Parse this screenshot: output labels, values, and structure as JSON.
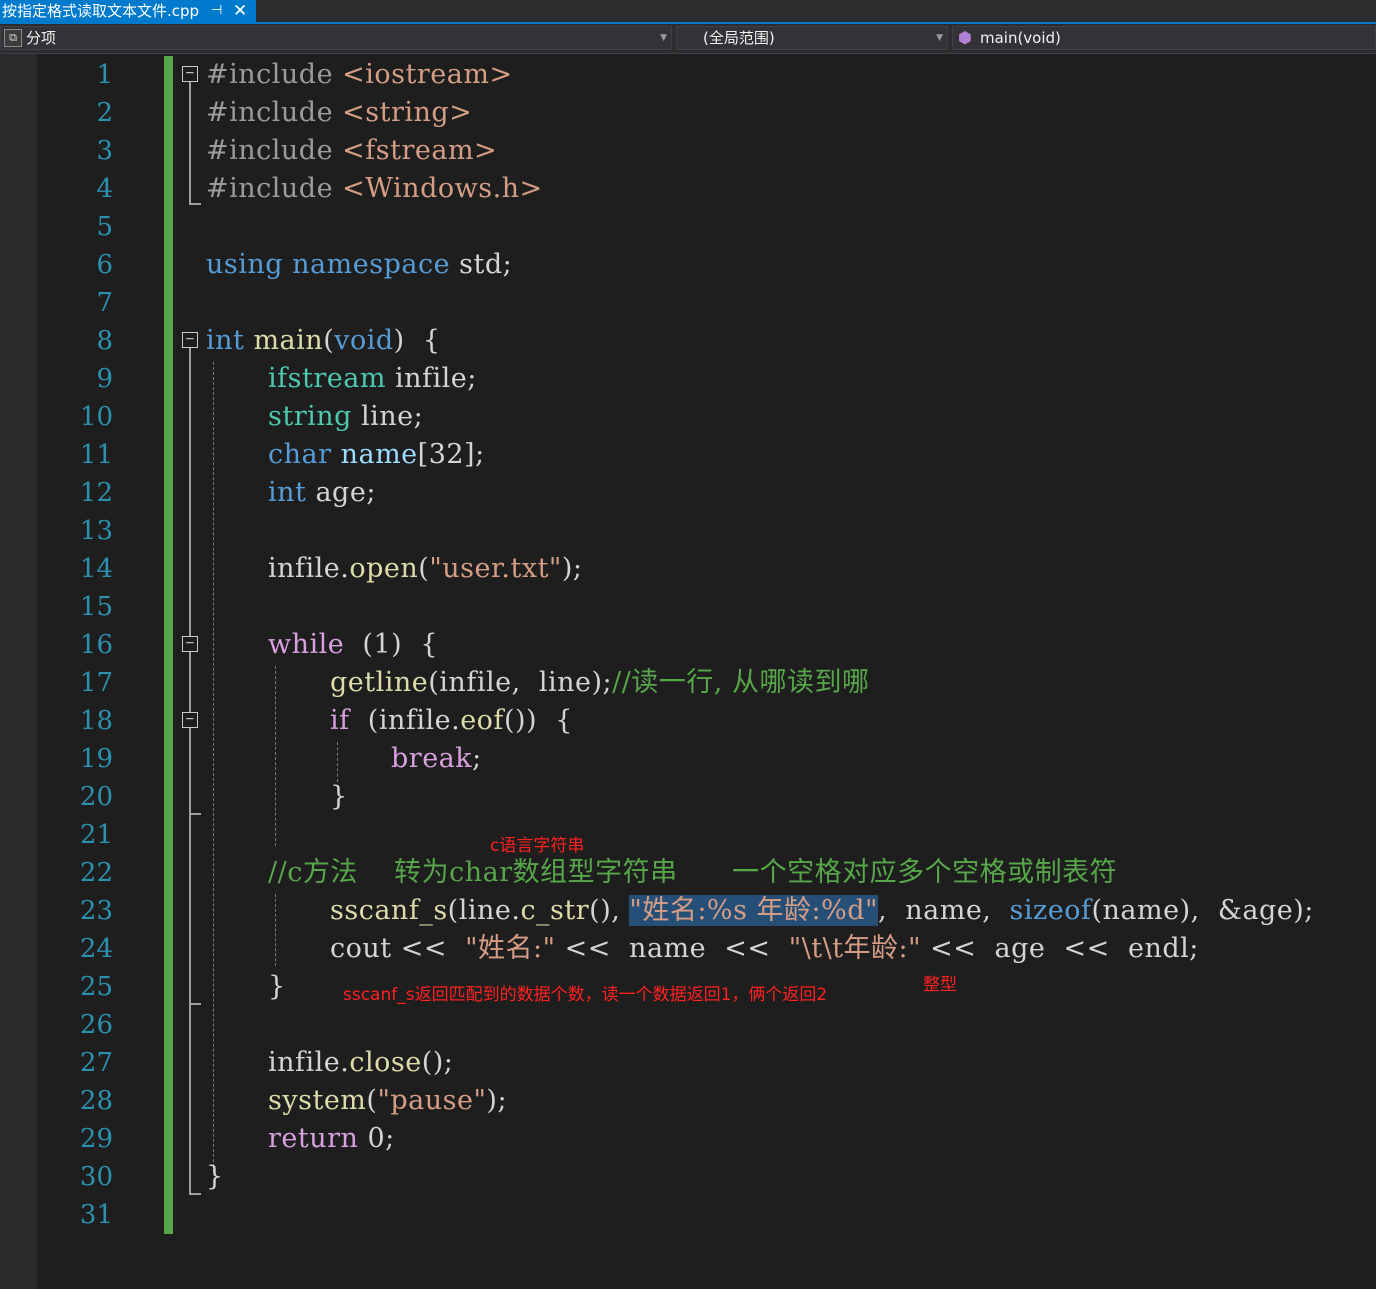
{
  "tab": {
    "filename": "按指定格式读取文本文件.cpp",
    "pin_glyph": "⊣",
    "close_glyph": "✕"
  },
  "navbar": {
    "project": "分项",
    "scope": "(全局范围)",
    "member": "main(void)"
  },
  "line_numbers": [
    "1",
    "2",
    "3",
    "4",
    "5",
    "6",
    "7",
    "8",
    "9",
    "10",
    "11",
    "12",
    "13",
    "14",
    "15",
    "16",
    "17",
    "18",
    "19",
    "20",
    "21",
    "22",
    "23",
    "24",
    "25",
    "26",
    "27",
    "28",
    "29",
    "30",
    "31"
  ],
  "code": {
    "l1": {
      "a": "#include ",
      "b": "<iostream>"
    },
    "l2": {
      "a": "#include ",
      "b": "<string>"
    },
    "l3": {
      "a": "#include ",
      "b": "<fstream>"
    },
    "l4": {
      "a": "#include ",
      "b": "<Windows.h>"
    },
    "l6": {
      "a": "using",
      "b": "namespace",
      "c": " std;"
    },
    "l8": {
      "a": "int",
      "b": " main",
      "c": "(",
      "d": "void",
      "e": ")  {"
    },
    "l9": {
      "a": "ifstream",
      "b": " infile;"
    },
    "l10": {
      "a": "string",
      "b": " line;"
    },
    "l11": {
      "a": "char",
      "b": " name",
      "c": "[32];"
    },
    "l12": {
      "a": "int",
      "b": " age;"
    },
    "l14": {
      "a": "infile.",
      "b": "open",
      "c": "(",
      "d": "\"user.txt\"",
      "e": ");"
    },
    "l16": {
      "a": "while",
      "b": "  (1)  {"
    },
    "l17": {
      "a": "getline",
      "b": "(infile,  line);",
      "c": "//读一行, 从哪读到哪"
    },
    "l18": {
      "a": "if",
      "b": "  (infile.",
      "c": "eof",
      "d": "())  {"
    },
    "l19": {
      "a": "break",
      "b": ";"
    },
    "l20": {
      "a": "}"
    },
    "l22": {
      "a": "//c方法    转为char数组型字符串      一个空格对应多个空格或制表符"
    },
    "l23": {
      "a": "sscanf_s",
      "b": "(line.",
      "c": "c_str",
      "d": "(), ",
      "e": "\"姓名:%s 年龄:%d\"",
      "f": ",  name,  ",
      "g": "sizeof",
      "h": "(name),  &age);"
    },
    "l24": {
      "a": "cout",
      "b": " <<  ",
      "c": "\"姓名:\"",
      "d": " <<  name  <<  ",
      "e": "\"\\t\\t年龄:\"",
      "f": " <<  age  <<  endl;"
    },
    "l25": {
      "a": "}"
    },
    "l27": {
      "a": "infile.",
      "b": "close",
      "c": "();"
    },
    "l28": {
      "a": "system",
      "b": "(",
      "c": "\"pause\"",
      "d": ");"
    },
    "l29": {
      "a": "return",
      "b": " 0;"
    },
    "l30": {
      "a": "}"
    }
  },
  "annotations": {
    "c_string": "c语言字符串",
    "sscanf_note": "sscanf_s返回匹配到的数据个数，读一个数据返回1，俩个返回2",
    "integer": "整型"
  },
  "colors": {
    "accent": "#007acc",
    "background": "#1e1e1e",
    "line_number": "#2b91af",
    "annotation": "#ff2020"
  }
}
